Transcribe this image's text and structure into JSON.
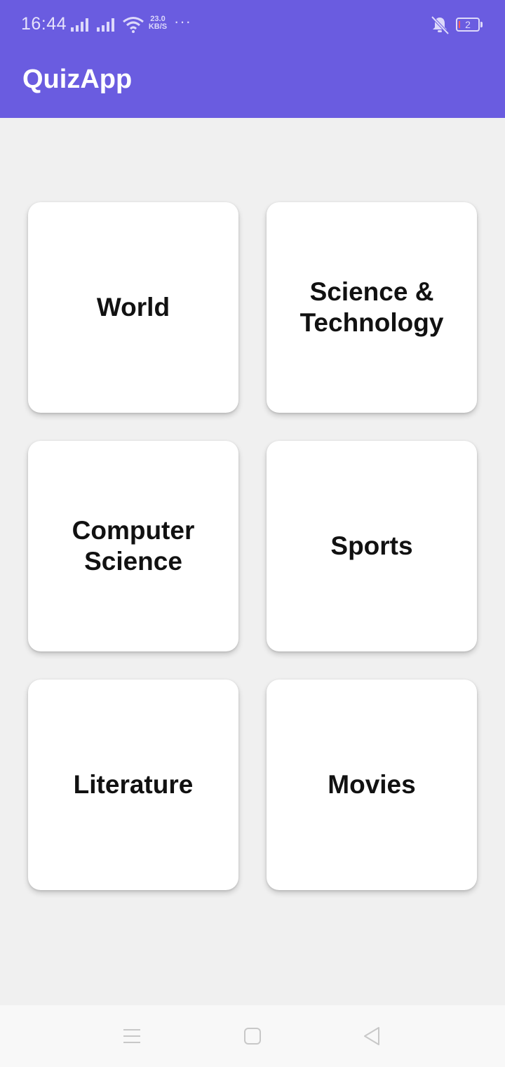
{
  "status_bar": {
    "time": "16:44",
    "net_speed_value": "23.0",
    "net_speed_unit": "KB/S",
    "more": "···",
    "battery": "2",
    "icons": [
      "signal-icon",
      "signal-icon",
      "wifi-icon",
      "mute-icon",
      "battery-icon"
    ]
  },
  "app_bar": {
    "title": "QuizApp",
    "color": "#6a5ce0"
  },
  "categories": [
    {
      "label": "World"
    },
    {
      "label": "Science & Technology"
    },
    {
      "label": "Computer Science"
    },
    {
      "label": "Sports"
    },
    {
      "label": "Literature"
    },
    {
      "label": "Movies"
    }
  ],
  "nav_bar": {
    "icons": [
      "menu-icon",
      "home-icon",
      "back-icon"
    ]
  }
}
